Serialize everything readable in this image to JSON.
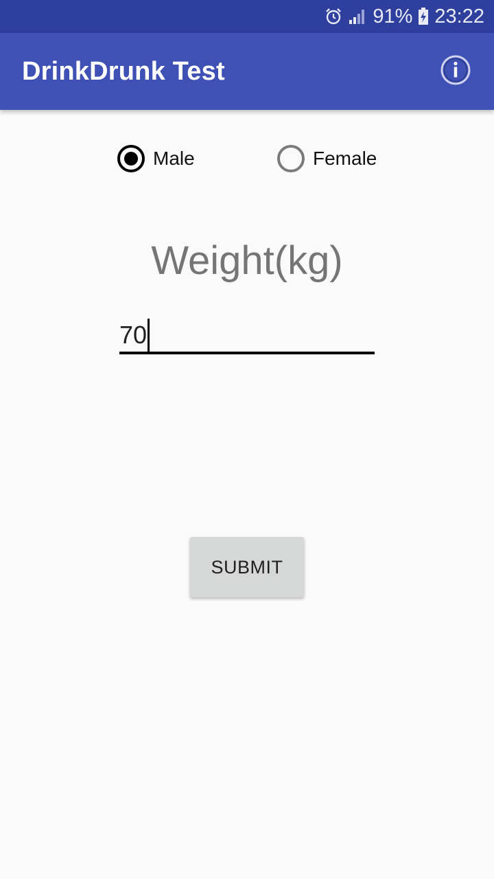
{
  "status_bar": {
    "battery": "91%",
    "time": "23:22",
    "icons": [
      "alarm-icon",
      "signal-icon",
      "battery-charging-icon"
    ]
  },
  "app_bar": {
    "title": "DrinkDrunk Test",
    "action_icon": "info-icon"
  },
  "gender": {
    "options": [
      {
        "label": "Male",
        "checked": true
      },
      {
        "label": "Female",
        "checked": false
      }
    ]
  },
  "weight": {
    "label": "Weight(kg)",
    "value": "70"
  },
  "submit": {
    "label": "SUBMIT"
  },
  "colors": {
    "status_bar": "#2f3f9e",
    "app_bar": "#3f51b5",
    "background": "#fafafa",
    "button": "#d6d7d7"
  }
}
